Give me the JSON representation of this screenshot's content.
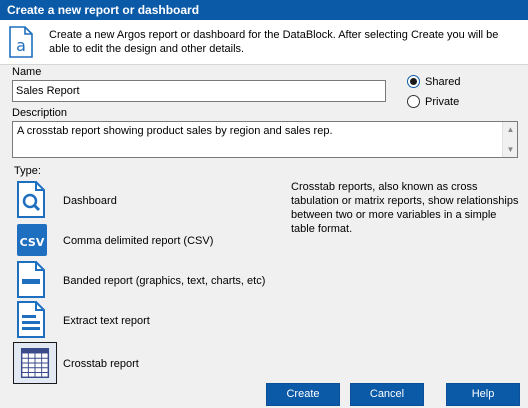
{
  "window": {
    "title": "Create a new report or dashboard"
  },
  "intro": {
    "icon": "argos-a-icon",
    "text": "Create a new Argos report or dashboard for the DataBlock.  After selecting Create you will be able to edit the design and other details."
  },
  "name": {
    "label": "Name",
    "value": "Sales Report"
  },
  "visibility": {
    "options": [
      {
        "label": "Shared",
        "selected": true
      },
      {
        "label": "Private",
        "selected": false
      }
    ]
  },
  "description": {
    "label": "Description",
    "value": "A crosstab report showing product sales by region and sales rep."
  },
  "type": {
    "label": "Type:",
    "items": [
      {
        "label": "Dashboard",
        "icon": "dashboard-magnifier-icon",
        "selected": false
      },
      {
        "label": "Comma delimited report (CSV)",
        "icon": "csv-icon",
        "selected": false
      },
      {
        "label": "Banded report (graphics, text, charts, etc)",
        "icon": "banded-report-icon",
        "selected": false
      },
      {
        "label": "Extract text report",
        "icon": "extract-text-icon",
        "selected": false
      },
      {
        "label": "Crosstab report",
        "icon": "crosstab-grid-icon",
        "selected": true
      }
    ],
    "help": "Crosstab reports, also known as cross tabulation or matrix reports, show relationships between two or more variables in a simple table format."
  },
  "buttons": {
    "create": "Create",
    "cancel": "Cancel",
    "help": "Help"
  },
  "colors": {
    "accent": "#0b5aa8",
    "titlebar": "#0b5aa8",
    "icon_blue": "#1e6fc0"
  }
}
